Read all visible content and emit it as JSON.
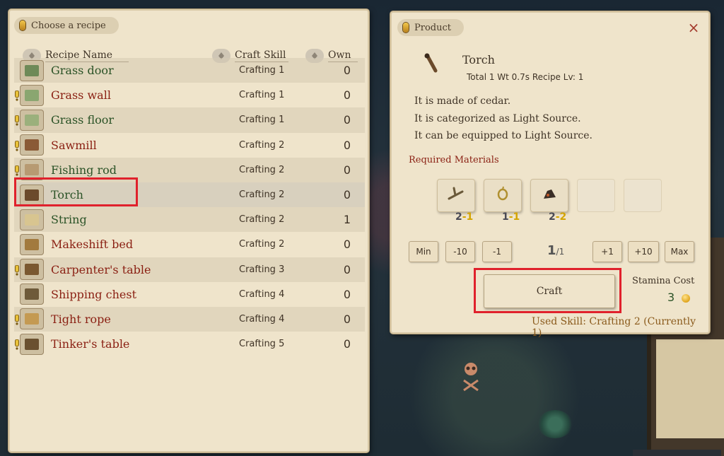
{
  "recipe_panel": {
    "tab_title": "Choose a recipe",
    "columns": {
      "name": "Recipe Name",
      "skill": "Craft Skill",
      "own": "Own"
    },
    "recipes": [
      {
        "name": "Grass door",
        "skill": "Crafting 1",
        "own": "0",
        "color": "green",
        "alert": false,
        "icon": "grass-door-icon"
      },
      {
        "name": "Grass wall",
        "skill": "Crafting 1",
        "own": "0",
        "color": "red",
        "alert": true,
        "icon": "grass-wall-icon"
      },
      {
        "name": "Grass floor",
        "skill": "Crafting 1",
        "own": "0",
        "color": "green",
        "alert": true,
        "icon": "grass-floor-icon"
      },
      {
        "name": "Sawmill",
        "skill": "Crafting 2",
        "own": "0",
        "color": "red",
        "alert": true,
        "icon": "sawmill-icon"
      },
      {
        "name": "Fishing rod",
        "skill": "Crafting 2",
        "own": "0",
        "color": "green",
        "alert": true,
        "icon": "fishing-rod-icon"
      },
      {
        "name": "Torch",
        "skill": "Crafting 2",
        "own": "0",
        "color": "green",
        "alert": false,
        "icon": "torch-icon",
        "selected": true
      },
      {
        "name": "String",
        "skill": "Crafting 2",
        "own": "1",
        "color": "green",
        "alert": false,
        "icon": "string-icon"
      },
      {
        "name": "Makeshift bed",
        "skill": "Crafting 2",
        "own": "0",
        "color": "red",
        "alert": false,
        "icon": "makeshift-bed-icon"
      },
      {
        "name": "Carpenter's table",
        "skill": "Crafting 3",
        "own": "0",
        "color": "red",
        "alert": true,
        "icon": "carpenters-table-icon"
      },
      {
        "name": "Shipping chest",
        "skill": "Crafting 4",
        "own": "0",
        "color": "red",
        "alert": false,
        "icon": "shipping-chest-icon"
      },
      {
        "name": "Tight rope",
        "skill": "Crafting 4",
        "own": "0",
        "color": "red",
        "alert": true,
        "icon": "tight-rope-icon"
      },
      {
        "name": "Tinker's table",
        "skill": "Crafting 5",
        "own": "0",
        "color": "red",
        "alert": true,
        "icon": "tinkers-table-icon"
      }
    ]
  },
  "product_panel": {
    "tab_title": "Product",
    "close_label": "×",
    "name": "Torch",
    "meta": "Total 1  Wt 0.7s  Recipe Lv: 1",
    "description": [
      "It is made of cedar.",
      "It is categorized as Light Source.",
      "It can be equipped to Light Source."
    ],
    "required_label": "Required Materials",
    "materials": [
      {
        "icon": "wood-branch-icon",
        "have": "2",
        "need": "-1"
      },
      {
        "icon": "string-coil-icon",
        "have": "1",
        "need": "-1"
      },
      {
        "icon": "stone-lump-icon",
        "have": "2",
        "need": "-2"
      }
    ],
    "quantity": {
      "min": "Min",
      "minus10": "-10",
      "minus1": "-1",
      "current": "1",
      "max_suffix": "/1",
      "plus1": "+1",
      "plus10": "+10",
      "max": "Max"
    },
    "craft_label": "Craft",
    "stamina_label": "Stamina Cost",
    "stamina_value": "3",
    "used_skill": "Used Skill: Crafting 2 (Currently 1)"
  },
  "colors": {
    "parchment": "#efe4cb",
    "name_green": "#2a5226",
    "name_red": "#8a1f12",
    "highlight_red": "#e0212c"
  }
}
